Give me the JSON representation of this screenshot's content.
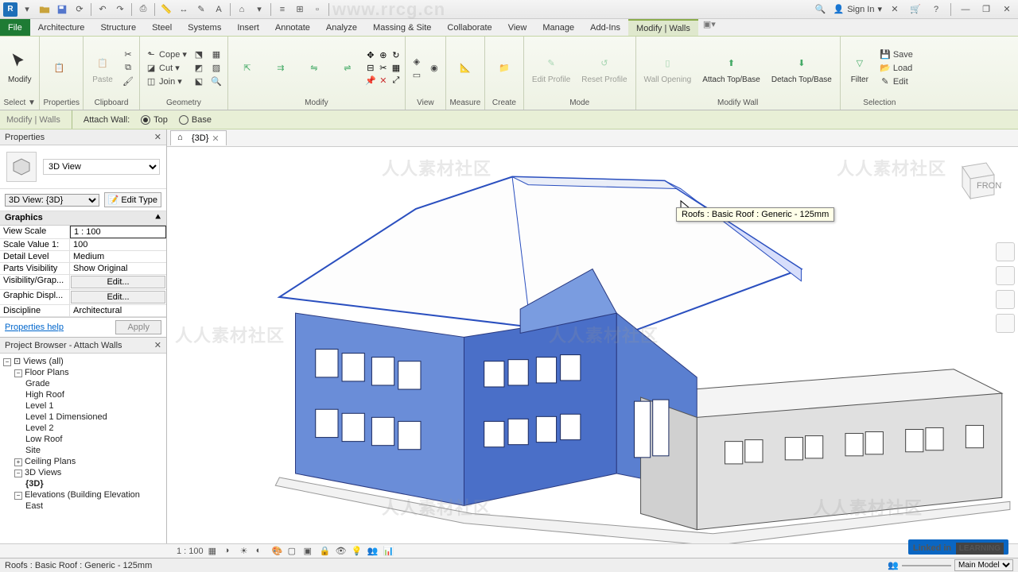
{
  "qat": {
    "signin": "Sign In"
  },
  "tabs": {
    "file": "File",
    "items": [
      "Architecture",
      "Structure",
      "Steel",
      "Systems",
      "Insert",
      "Annotate",
      "Analyze",
      "Massing & Site",
      "Collaborate",
      "View",
      "Manage",
      "Add-Ins"
    ],
    "active": "Modify | Walls"
  },
  "ribbon": {
    "select": {
      "modify": "Modify",
      "label": "Select ▼"
    },
    "properties": {
      "btn": "Properties",
      "label": "Properties"
    },
    "clipboard": {
      "paste": "Paste",
      "label": "Clipboard"
    },
    "geometry": {
      "cope": "Cope ▾",
      "cut": "Cut ▾",
      "join": "Join ▾",
      "label": "Geometry"
    },
    "modify": {
      "label": "Modify"
    },
    "view": {
      "label": "View"
    },
    "measure": {
      "label": "Measure"
    },
    "create": {
      "label": "Create"
    },
    "mode": {
      "edit_profile": "Edit\nProfile",
      "reset_profile": "Reset\nProfile",
      "label": "Mode"
    },
    "modify_wall": {
      "wall_opening": "Wall\nOpening",
      "attach": "Attach\nTop/Base",
      "detach": "Detach\nTop/Base",
      "label": "Modify Wall"
    },
    "selection": {
      "filter": "Filter",
      "save": "Save",
      "load": "Load",
      "edit": "Edit",
      "label": "Selection"
    }
  },
  "optbar": {
    "context": "Modify | Walls",
    "attach": "Attach Wall:",
    "top": "Top",
    "base": "Base"
  },
  "properties": {
    "title": "Properties",
    "type": "3D View",
    "instance": "3D View: {3D}",
    "edit_type": "Edit Type",
    "section": "Graphics",
    "rows": [
      {
        "k": "View Scale",
        "v": "1 : 100"
      },
      {
        "k": "Scale Value   1:",
        "v": "100"
      },
      {
        "k": "Detail Level",
        "v": "Medium"
      },
      {
        "k": "Parts Visibility",
        "v": "Show Original"
      },
      {
        "k": "Visibility/Grap...",
        "v": "Edit...",
        "btn": true
      },
      {
        "k": "Graphic Displ...",
        "v": "Edit...",
        "btn": true
      },
      {
        "k": "Discipline",
        "v": "Architectural"
      }
    ],
    "help": "Properties help",
    "apply": "Apply"
  },
  "browser": {
    "title": "Project Browser - Attach Walls",
    "views_root": "Views (all)",
    "floor_plans": "Floor Plans",
    "fp_items": [
      "Grade",
      "High Roof",
      "Level 1",
      "Level 1 Dimensioned",
      "Level 2",
      "Low Roof",
      "Site"
    ],
    "ceiling": "Ceiling Plans",
    "threed": "3D Views",
    "threed_item": "{3D}",
    "elev": "Elevations (Building Elevation",
    "elev_item": "East"
  },
  "viewtab": {
    "name": "{3D}"
  },
  "tooltip": "Roofs : Basic Roof : Generic - 125mm",
  "vcb": {
    "scale": "1 : 100"
  },
  "status": {
    "msg": "Roofs : Basic Roof : Generic - 125mm",
    "model": "Main Model"
  },
  "watermark": "人人素材社区",
  "linkedin": "Linked in",
  "learning": "LEARNING"
}
